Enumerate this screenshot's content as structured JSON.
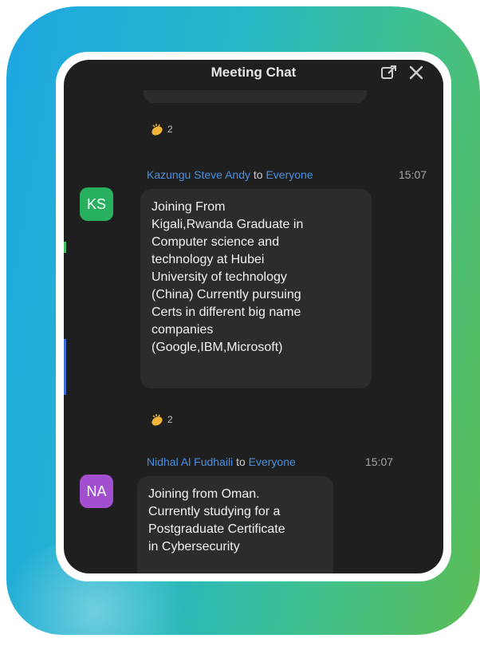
{
  "chat": {
    "title": "Meeting Chat",
    "header_icons": [
      "popout-icon",
      "close-icon"
    ]
  },
  "reactions": [
    {
      "emoji_icon": "clapping-hands-icon",
      "count": "2"
    },
    {
      "emoji_icon": "clapping-hands-icon",
      "count": "2"
    }
  ],
  "messages": [
    {
      "avatar_initials": "KS",
      "avatar_color": "#27b15f",
      "sender": "Kazungu Steve Andy",
      "to_word": "to",
      "recipient": "Everyone",
      "time": "15:07",
      "lines": [
        "Joining From",
        "Kigali,Rwanda Graduate in",
        "Computer science and",
        "technology at Hubei",
        "University of technology",
        "(China) Currently pursuing",
        "Certs in different big name",
        "companies",
        "(Google,IBM,Microsoft)"
      ]
    },
    {
      "avatar_initials": "NA",
      "avatar_color": "#a24fcf",
      "sender": "Nidhal Al Fudhaili",
      "to_word": "to",
      "recipient": "Everyone",
      "time": "15:07",
      "lines": [
        "Joining from Oman.",
        "Currently studying for a",
        "Postgraduate Certificate",
        "in Cybersecurity"
      ]
    }
  ],
  "colors": {
    "frame_gradient_start": "#1ea7e1",
    "frame_gradient_end": "#5cbd55",
    "chat_background": "#1f1f1f",
    "bubble_background": "#2c2c2c",
    "name_link": "#4a90e2"
  }
}
